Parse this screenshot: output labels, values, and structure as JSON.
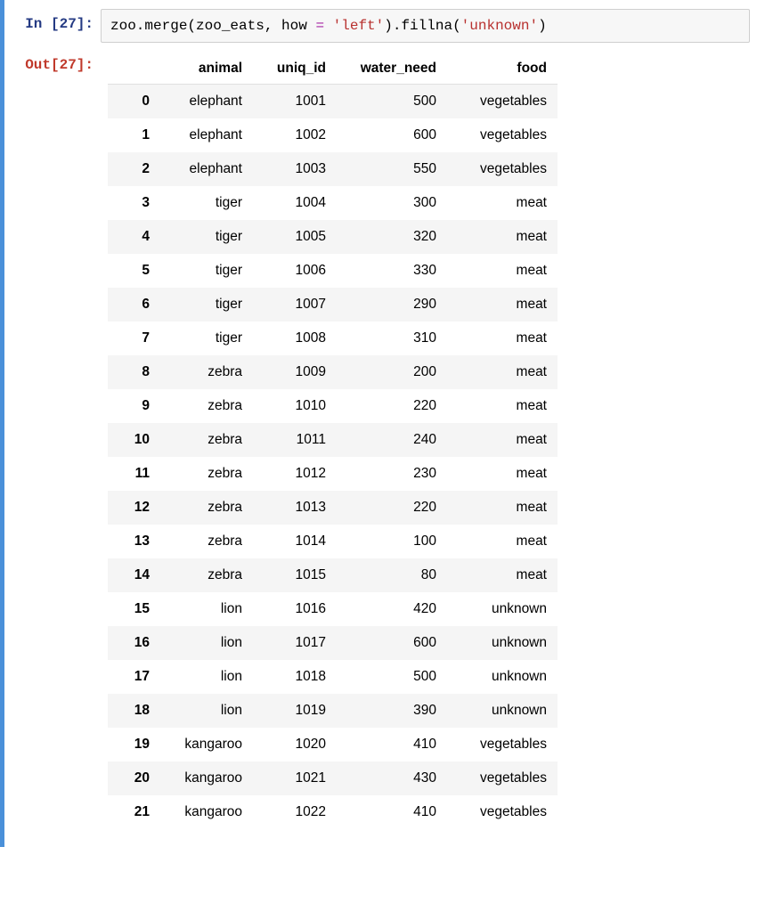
{
  "input_prompt": "In [27]:",
  "output_prompt": "Out[27]:",
  "code": {
    "part1": "zoo.merge(zoo_eats, how ",
    "eq": "= ",
    "str1": "'left'",
    "part2": ").fillna(",
    "str2": "'unknown'",
    "part3": ")"
  },
  "table": {
    "columns": [
      "animal",
      "uniq_id",
      "water_need",
      "food"
    ],
    "rows": [
      {
        "idx": "0",
        "animal": "elephant",
        "uniq_id": "1001",
        "water_need": "500",
        "food": "vegetables"
      },
      {
        "idx": "1",
        "animal": "elephant",
        "uniq_id": "1002",
        "water_need": "600",
        "food": "vegetables"
      },
      {
        "idx": "2",
        "animal": "elephant",
        "uniq_id": "1003",
        "water_need": "550",
        "food": "vegetables"
      },
      {
        "idx": "3",
        "animal": "tiger",
        "uniq_id": "1004",
        "water_need": "300",
        "food": "meat"
      },
      {
        "idx": "4",
        "animal": "tiger",
        "uniq_id": "1005",
        "water_need": "320",
        "food": "meat"
      },
      {
        "idx": "5",
        "animal": "tiger",
        "uniq_id": "1006",
        "water_need": "330",
        "food": "meat"
      },
      {
        "idx": "6",
        "animal": "tiger",
        "uniq_id": "1007",
        "water_need": "290",
        "food": "meat"
      },
      {
        "idx": "7",
        "animal": "tiger",
        "uniq_id": "1008",
        "water_need": "310",
        "food": "meat"
      },
      {
        "idx": "8",
        "animal": "zebra",
        "uniq_id": "1009",
        "water_need": "200",
        "food": "meat"
      },
      {
        "idx": "9",
        "animal": "zebra",
        "uniq_id": "1010",
        "water_need": "220",
        "food": "meat"
      },
      {
        "idx": "10",
        "animal": "zebra",
        "uniq_id": "1011",
        "water_need": "240",
        "food": "meat"
      },
      {
        "idx": "11",
        "animal": "zebra",
        "uniq_id": "1012",
        "water_need": "230",
        "food": "meat"
      },
      {
        "idx": "12",
        "animal": "zebra",
        "uniq_id": "1013",
        "water_need": "220",
        "food": "meat"
      },
      {
        "idx": "13",
        "animal": "zebra",
        "uniq_id": "1014",
        "water_need": "100",
        "food": "meat"
      },
      {
        "idx": "14",
        "animal": "zebra",
        "uniq_id": "1015",
        "water_need": "80",
        "food": "meat"
      },
      {
        "idx": "15",
        "animal": "lion",
        "uniq_id": "1016",
        "water_need": "420",
        "food": "unknown"
      },
      {
        "idx": "16",
        "animal": "lion",
        "uniq_id": "1017",
        "water_need": "600",
        "food": "unknown"
      },
      {
        "idx": "17",
        "animal": "lion",
        "uniq_id": "1018",
        "water_need": "500",
        "food": "unknown"
      },
      {
        "idx": "18",
        "animal": "lion",
        "uniq_id": "1019",
        "water_need": "390",
        "food": "unknown"
      },
      {
        "idx": "19",
        "animal": "kangaroo",
        "uniq_id": "1020",
        "water_need": "410",
        "food": "vegetables"
      },
      {
        "idx": "20",
        "animal": "kangaroo",
        "uniq_id": "1021",
        "water_need": "430",
        "food": "vegetables"
      },
      {
        "idx": "21",
        "animal": "kangaroo",
        "uniq_id": "1022",
        "water_need": "410",
        "food": "vegetables"
      }
    ]
  }
}
